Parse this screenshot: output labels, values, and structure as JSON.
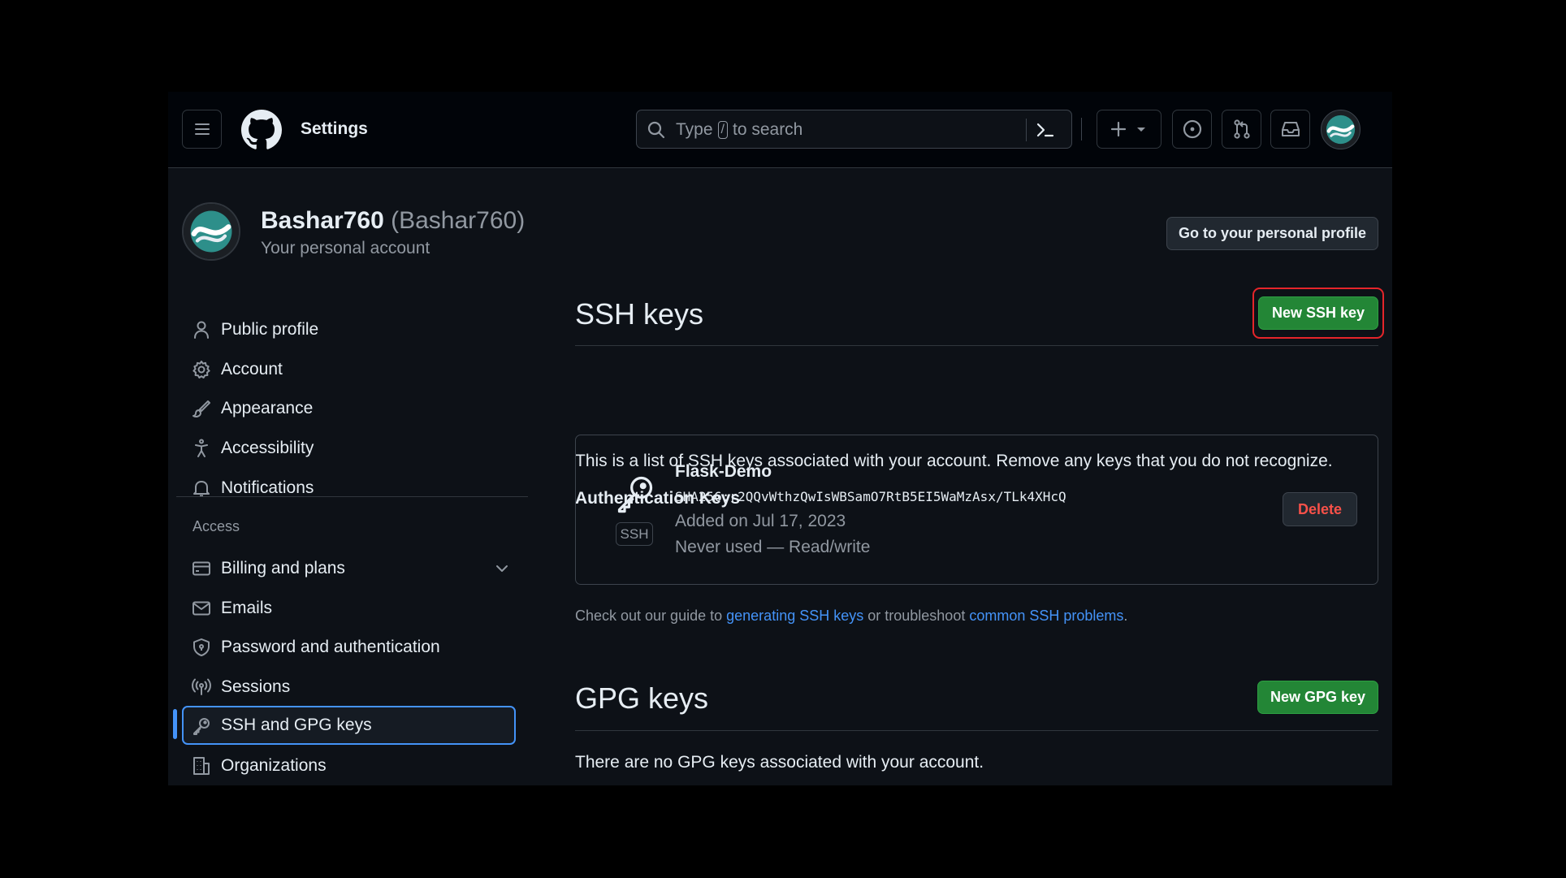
{
  "header": {
    "title": "Settings",
    "search_prefix": "Type",
    "search_slash": "/",
    "search_suffix": "to search",
    "plus_icon": "plus-icon",
    "issues_icon": "issue-opened-icon",
    "pulls_icon": "git-pull-request-icon",
    "inbox_icon": "inbox-icon"
  },
  "user": {
    "display_name": "Bashar760",
    "login": "(Bashar760)",
    "subtitle": "Your personal account",
    "profile_button": "Go to your personal profile"
  },
  "sidebar": {
    "items": [
      {
        "label": "Public profile",
        "icon": "person-icon"
      },
      {
        "label": "Account",
        "icon": "gear-icon"
      },
      {
        "label": "Appearance",
        "icon": "paintbrush-icon"
      },
      {
        "label": "Accessibility",
        "icon": "accessibility-icon"
      },
      {
        "label": "Notifications",
        "icon": "bell-icon"
      }
    ],
    "access_heading": "Access",
    "access_items": [
      {
        "label": "Billing and plans",
        "icon": "credit-card-icon"
      },
      {
        "label": "Emails",
        "icon": "mail-icon"
      },
      {
        "label": "Password and authentication",
        "icon": "shield-lock-icon"
      },
      {
        "label": "Sessions",
        "icon": "broadcast-icon"
      },
      {
        "label": "SSH and GPG keys",
        "icon": "key-icon",
        "active": true
      },
      {
        "label": "Organizations",
        "icon": "organization-icon"
      }
    ]
  },
  "ssh": {
    "heading": "SSH keys",
    "new_button": "New SSH key",
    "description": "This is a list of SSH keys associated with your account. Remove any keys that you do not recognize.",
    "auth_heading": "Authentication Keys",
    "key": {
      "title": "Flask-Demo",
      "fingerprint": "SHA256:r2QQvWthzQwIsWBSamO7RtB5EI5WaMzAsx/TLk4XHcQ",
      "added": "Added on Jul 17, 2023",
      "usage": "Never used — Read/write",
      "badge": "SSH",
      "delete_button": "Delete"
    },
    "guide_prefix": "Check out our guide to",
    "guide_link1": "generating SSH keys",
    "guide_middle": "or troubleshoot",
    "guide_link2": "common SSH problems",
    "guide_suffix": "."
  },
  "gpg": {
    "heading": "GPG keys",
    "new_button": "New GPG key",
    "description": "There are no GPG keys associated with your account."
  },
  "colors": {
    "accent": "#4493f8",
    "primary_button": "#238636",
    "danger": "#f85149",
    "highlight_box": "#e5252a"
  }
}
